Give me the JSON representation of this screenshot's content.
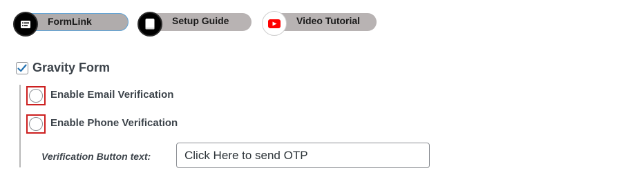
{
  "tabs": [
    {
      "label": "FormLink",
      "icon": "form-list-icon",
      "selected": true
    },
    {
      "label": "Setup Guide",
      "icon": "book-icon",
      "selected": false
    },
    {
      "label": "Video Tutorial",
      "icon": "youtube-play-icon",
      "selected": false
    }
  ],
  "section": {
    "title": "Gravity Form",
    "checked": true
  },
  "options": [
    {
      "label": "Enable Email Verification",
      "checked": false
    },
    {
      "label": "Enable Phone Verification",
      "checked": false
    }
  ],
  "verification": {
    "label": "Verification Button text:",
    "value": "Click Here to send OTP"
  },
  "colors": {
    "check_accent": "#2271b1",
    "highlight_border": "#cc1f1f",
    "youtube_red": "#ff0000"
  }
}
